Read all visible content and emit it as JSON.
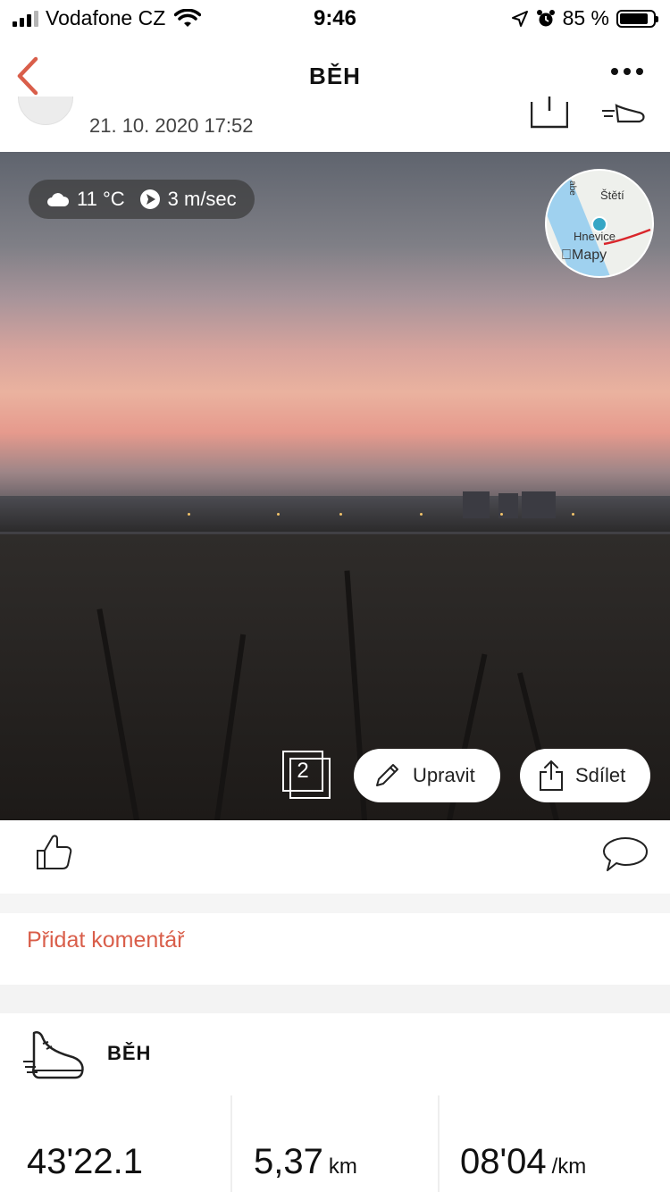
{
  "status_bar": {
    "carrier": "Vodafone CZ",
    "time": "9:46",
    "battery": "85 %",
    "battery_level": 0.85
  },
  "nav": {
    "title": "BĚH"
  },
  "header": {
    "date": "21. 10. 2020 17:52"
  },
  "photo": {
    "weather": {
      "temperature": "11 °C",
      "wind": "3 m/sec"
    },
    "map": {
      "place_1": "Štětí",
      "place_2": "Hnevice",
      "provider": "Mapy",
      "river": "abe"
    },
    "photo_count": "2",
    "edit_label": "Upravit",
    "share_label": "Sdílet"
  },
  "comments": {
    "add_label": "Přidat komentář"
  },
  "stats": {
    "activity": "BĚH",
    "duration": "43'22.1",
    "distance": "5,37",
    "distance_unit": "km",
    "pace": "08'04",
    "pace_unit": "/km"
  },
  "colors": {
    "accent": "#d95e4a",
    "text": "#111111"
  }
}
